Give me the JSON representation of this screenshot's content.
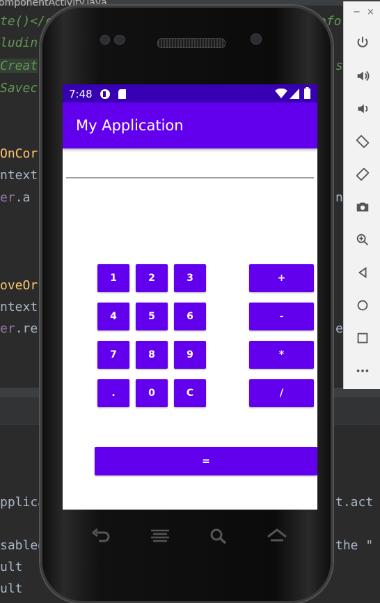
{
  "ide": {
    "tab_text": "omponentActivity.java",
    "lines": [
      {
        "pre": "",
        "hl": "te()</c",
        "post": "",
        "cls": "c-it"
      },
      {
        "pre": "",
        "hl": "ludin",
        "post": "",
        "cls": "c-it"
      },
      {
        "pre": "",
        "hl": "Creat",
        "post": "",
        "cls": "c-it"
      },
      {
        "pre": "",
        "hl": "Savec",
        "post": "",
        "cls": "c-it"
      },
      {
        "pre": "",
        "hl": "OnCor",
        "post": "",
        "cls": "c-fn"
      },
      {
        "pre": "",
        "hl": "",
        "post": "ntext",
        "cls": "c-str"
      },
      {
        "pre": "",
        "hl": "er",
        "post": ".a",
        "cls": "c-kw"
      },
      {
        "pre": "",
        "hl": "oveOr",
        "post": "",
        "cls": "c-fn"
      },
      {
        "pre": "",
        "hl": "",
        "post": "ntext",
        "cls": "c-str"
      },
      {
        "pre": "",
        "hl": "er",
        "post": ".re",
        "cls": "c-kw"
      }
    ],
    "right_fragments": [
      "efo",
      "s",
      "n",
      "e"
    ],
    "bottom_lines": [
      "pplica",
      "sabled",
      "ult",
      "ult"
    ],
    "bottom_right": [
      "t.act",
      "the \""
    ]
  },
  "emulator": {
    "minimize": "−",
    "close": "×",
    "tools": [
      "power-icon",
      "volume-up-icon",
      "volume-down-icon",
      "rotate-left-icon",
      "rotate-right-icon",
      "camera-icon",
      "zoom-icon",
      "back-icon",
      "home-icon",
      "overview-icon",
      "more-icon"
    ]
  },
  "status": {
    "time": "7:48"
  },
  "app": {
    "title": "My Application",
    "display_value": "",
    "keys": {
      "k1": "1",
      "k2": "2",
      "k3": "3",
      "k4": "4",
      "k5": "5",
      "k6": "6",
      "k7": "7",
      "k8": "8",
      "k9": "9",
      "kdot": ".",
      "k0": "0",
      "kclear": "C",
      "plus": "+",
      "minus": "-",
      "times": "*",
      "divide": "/",
      "equals": "="
    }
  },
  "colors": {
    "primary": "#6200ee",
    "primary_dark": "#3700b3",
    "ide_bg": "#2b2b2b"
  }
}
